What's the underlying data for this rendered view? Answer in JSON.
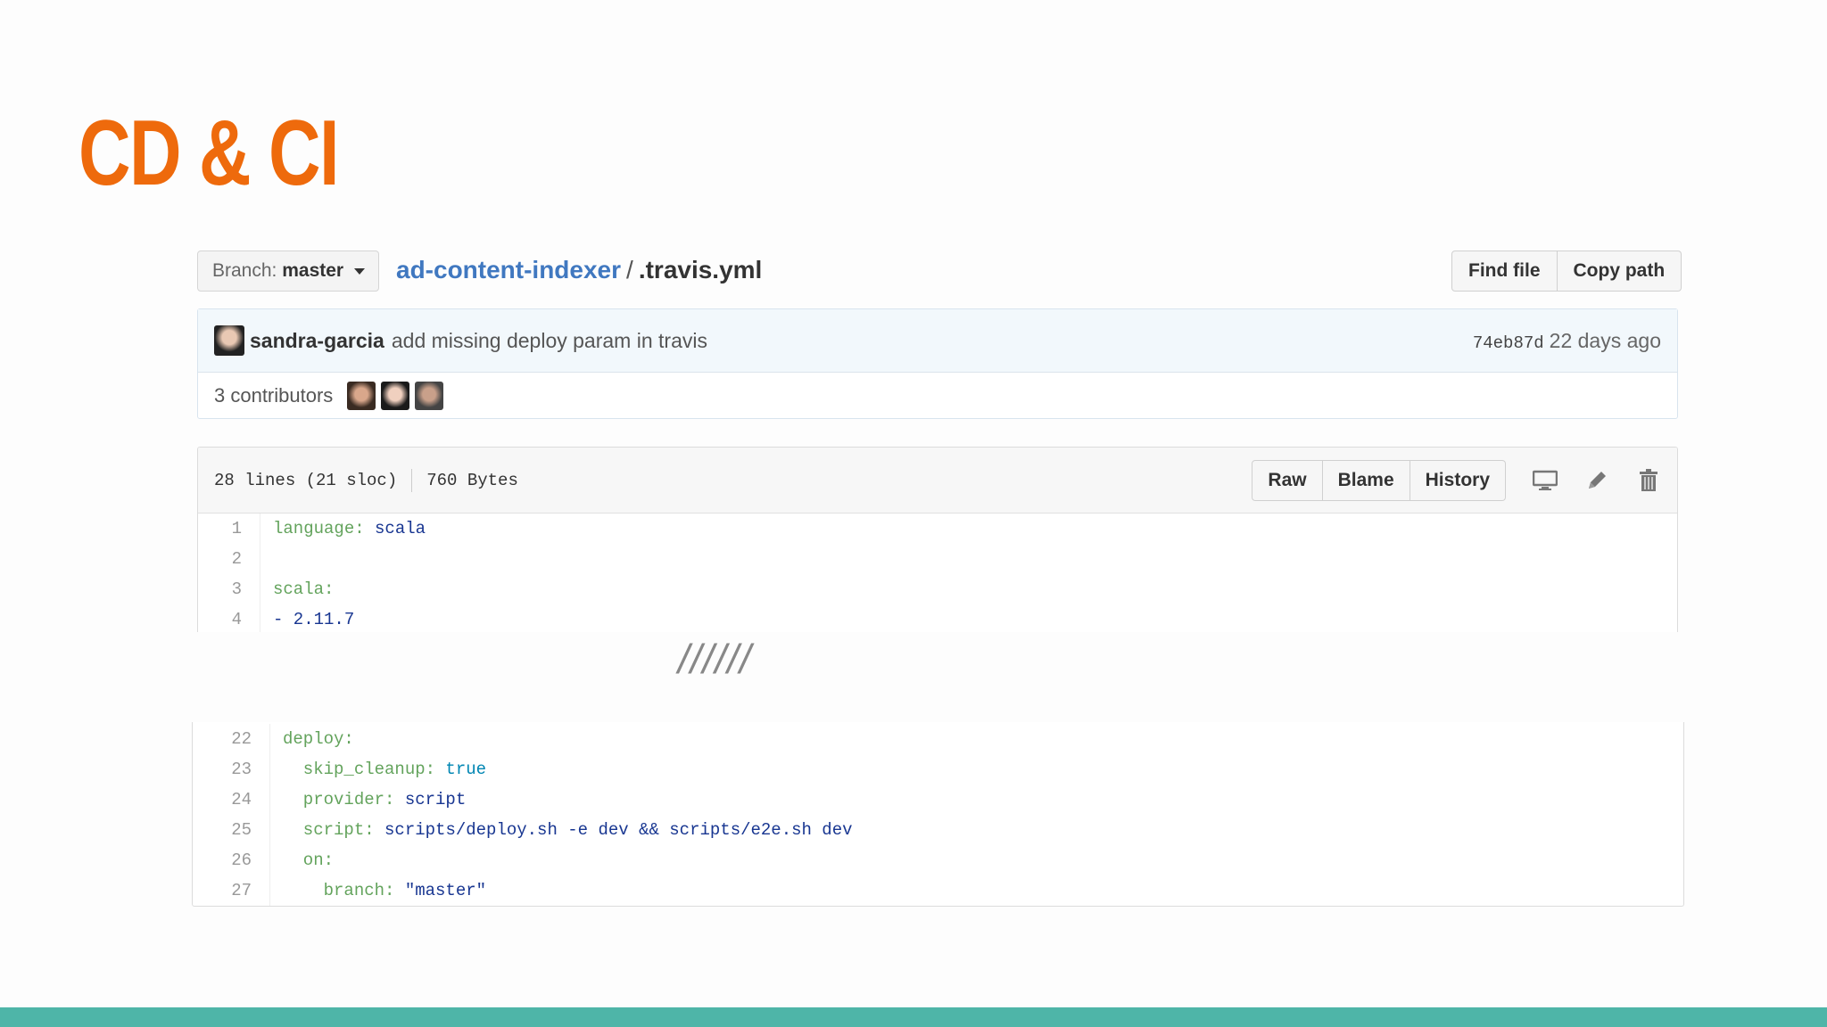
{
  "slide": {
    "title": "CD & CI",
    "break_mark": "//////"
  },
  "header": {
    "branch_prefix": "Branch:",
    "branch_name": "master",
    "repo": "ad-content-indexer",
    "separator": "/",
    "file": ".travis.yml",
    "find_file": "Find file",
    "copy_path": "Copy path"
  },
  "commit": {
    "author": "sandra-garcia",
    "message": "add missing deploy param in travis",
    "sha": "74eb87d",
    "age": "22 days ago",
    "contributors": "3 contributors"
  },
  "file": {
    "lines": "28 lines (21 sloc)",
    "size": "760 Bytes",
    "raw": "Raw",
    "blame": "Blame",
    "history": "History"
  },
  "code_top": [
    {
      "n": "1",
      "key": "language:",
      "val": " scala",
      "type": "v"
    },
    {
      "n": "2",
      "key": "",
      "val": "",
      "type": "v"
    },
    {
      "n": "3",
      "key": "scala:",
      "val": "",
      "type": "v"
    },
    {
      "n": "4",
      "key": "",
      "val": "- 2.11.7",
      "type": "v"
    }
  ],
  "code_bottom": [
    {
      "n": "22",
      "key": "deploy:",
      "val": "",
      "type": "v"
    },
    {
      "n": "23",
      "key": "  skip_cleanup:",
      "val": " true",
      "type": "t"
    },
    {
      "n": "24",
      "key": "  provider:",
      "val": " script",
      "type": "v"
    },
    {
      "n": "25",
      "key": "  script:",
      "val": " scripts/deploy.sh -e dev && scripts/e2e.sh dev",
      "type": "v"
    },
    {
      "n": "26",
      "key": "  on:",
      "val": "",
      "type": "v"
    },
    {
      "n": "27",
      "key": "    branch:",
      "val": " \"master\"",
      "type": "v"
    }
  ]
}
